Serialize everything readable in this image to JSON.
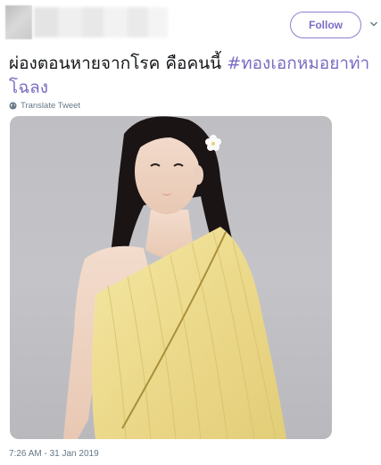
{
  "header": {
    "follow_label": "Follow"
  },
  "tweet": {
    "text_main": "ผ่องตอนหายจากโรค คือคนนี้ ",
    "hashtag_part1": "#ทองเอกหมอยาท่า",
    "hashtag_part2": "โฉลง",
    "translate_label": "Translate Tweet",
    "timestamp": "7:26 AM - 31 Jan 2019"
  },
  "colors": {
    "accent": "#7c6bc4",
    "muted": "#657786",
    "text": "#14171a"
  },
  "icons": {
    "translate": "globe-icon",
    "menu": "chevron-down-icon"
  }
}
